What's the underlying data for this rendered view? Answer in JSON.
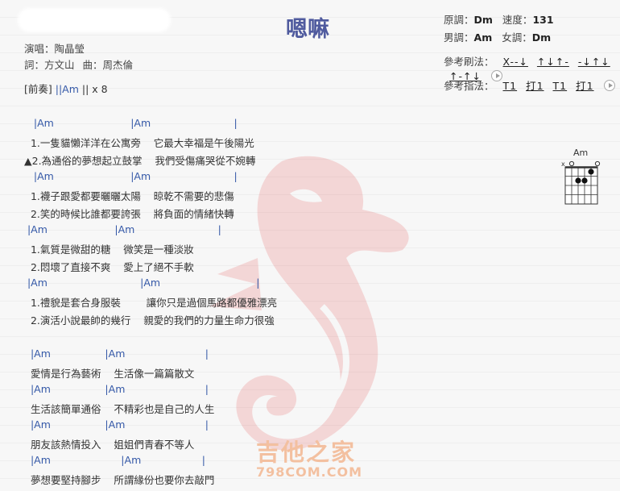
{
  "header": {
    "title": "嗯嘛",
    "singer": "演唱：陶晶瑩",
    "lyricist": "詞：方文山",
    "composer": "曲：周杰倫"
  },
  "key_info": {
    "orig_key_label": "原調：",
    "orig_key": "Dm",
    "tempo_label": "速度：",
    "tempo": "131",
    "male_key_label": "男調：",
    "male_key": "Am",
    "female_key_label": "女調：",
    "female_key": "Dm"
  },
  "strum": {
    "label": "參考刷法：",
    "patterns": [
      "X--↓",
      "↑↓↑-",
      "-↓↑↓",
      "↑-↑↓"
    ]
  },
  "picking": {
    "label": "參考指法：",
    "patterns": [
      "T1",
      "打1",
      "T1",
      "打1"
    ]
  },
  "intro": {
    "label": "[前奏]",
    "bars": "||Am",
    "repeat": "|| x 8"
  },
  "sheet": [
    {
      "type": "chord",
      "text": "   |Am                        |Am                          |"
    },
    {
      "type": "lyric",
      "text": "  1.一隻貓懶洋洋在公寓旁    它最大幸福是午後陽光"
    },
    {
      "type": "lyric",
      "text": "▲2.為通俗的夢想起立鼓掌    我們受傷痛哭從不婉轉"
    },
    {
      "type": "chord",
      "text": "   |Am                        |Am                          |"
    },
    {
      "type": "lyric",
      "text": "  1.襪子跟愛都要曬曬太陽    晾乾不需要的悲傷"
    },
    {
      "type": "lyric",
      "text": "  2.笑的時候比誰都要誇張    將負面的情緒快轉"
    },
    {
      "type": "chord",
      "text": " |Am                     |Am                          |"
    },
    {
      "type": "lyric",
      "text": "  1.氣質是微甜的糖    微笑是一種淡妝"
    },
    {
      "type": "lyric",
      "text": "  2.悶壞了直接不爽    愛上了絕不手軟"
    },
    {
      "type": "chord",
      "text": " |Am                             |Am                              |"
    },
    {
      "type": "lyric",
      "text": "  1.禮貌是套合身服裝        讓你只是過個馬路都優雅漂亮"
    },
    {
      "type": "lyric",
      "text": "  2.演活小說最帥的幾行    親愛的我們的力量生命力很強"
    },
    {
      "type": "chord",
      "text": "  |Am                 |Am                         |"
    },
    {
      "type": "lyric",
      "text": "  愛情是行為藝術    生活像一篇篇散文"
    },
    {
      "type": "chord",
      "text": "  |Am                 |Am                         |"
    },
    {
      "type": "lyric",
      "text": "  生活該簡單通俗    不精彩也是自己的人生"
    },
    {
      "type": "chord",
      "text": "  |Am                 |Am                         |"
    },
    {
      "type": "lyric",
      "text": "  朋友該熱情投入    姐姐們青春不等人"
    },
    {
      "type": "chord",
      "text": "  |Am                      |Am                   |"
    },
    {
      "type": "lyric",
      "text": "  夢想要堅持腳步    所謂緣份也要你去敲門"
    }
  ],
  "chord_diagram": {
    "name": "Am",
    "mute_mark": "x"
  },
  "watermark": {
    "site_name": "吉他之家",
    "site_url": "798COM.COM"
  },
  "colors": {
    "title": "#4f5a9e",
    "chord": "#3559a8",
    "watermark": "#e05050"
  }
}
